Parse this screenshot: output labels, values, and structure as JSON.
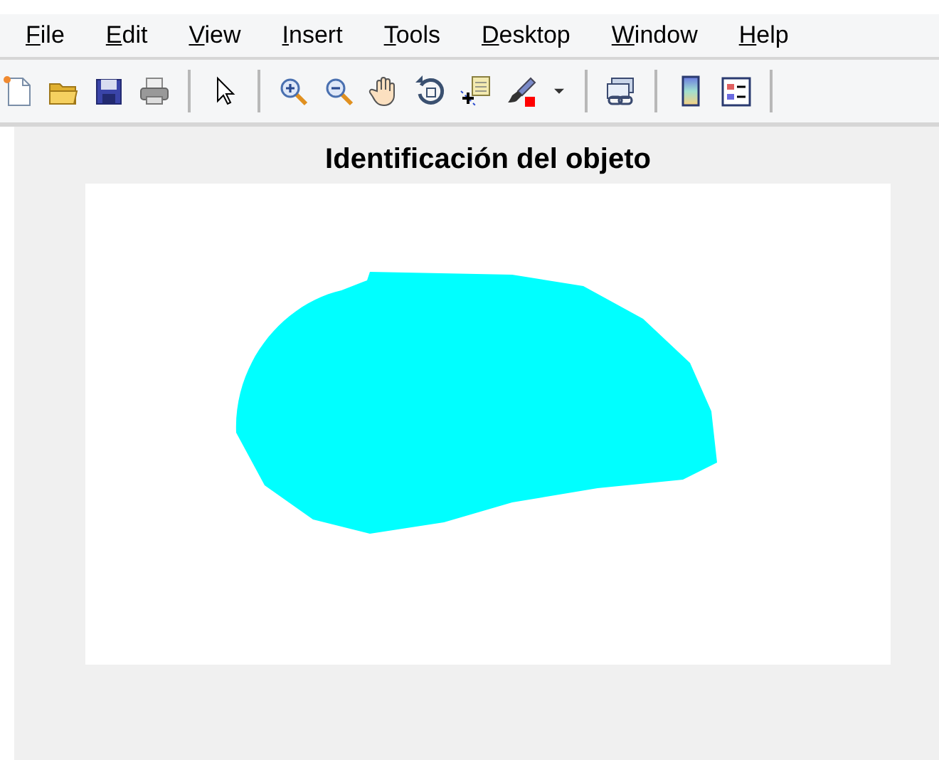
{
  "menu_bar": {
    "items": [
      "File",
      "Edit",
      "View",
      "Insert",
      "Tools",
      "Desktop",
      "Window",
      "Help"
    ]
  },
  "axes": {
    "title": "Identificación del objeto",
    "region": {
      "color": "#00ffff"
    }
  }
}
